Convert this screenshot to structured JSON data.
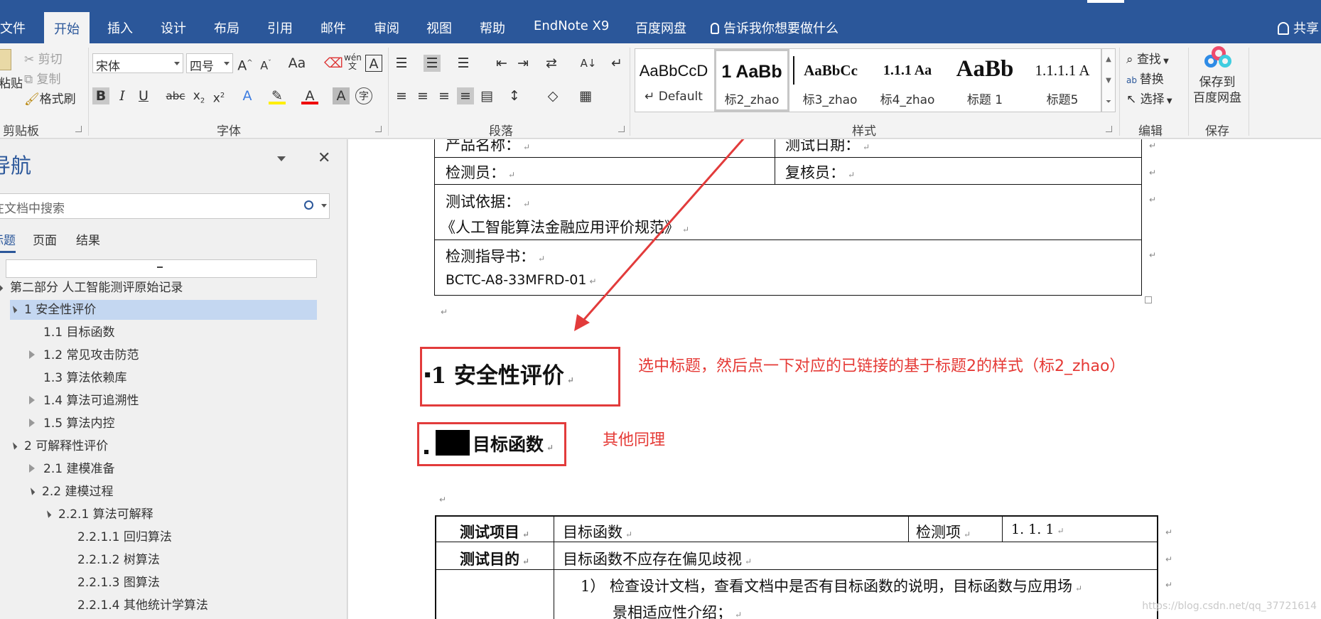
{
  "ribbon_tabs": [
    "文件",
    "开始",
    "插入",
    "设计",
    "布局",
    "引用",
    "邮件",
    "审阅",
    "视图",
    "帮助",
    "EndNote X9",
    "百度网盘"
  ],
  "tell_me": "告诉我你想要做什么",
  "share": "共享",
  "clipboard": {
    "paste": "粘贴",
    "cut": "剪切",
    "copy": "复制",
    "format_painter": "格式刷",
    "group": "剪贴板"
  },
  "font": {
    "name": "宋体",
    "size": "四号",
    "group": "字体"
  },
  "paragraph": {
    "group": "段落"
  },
  "styles": {
    "group": "样式",
    "items": [
      {
        "sample": "AaBbCcD",
        "name": "↵ Default"
      },
      {
        "sample": "1  AaBb",
        "name": "标2_zhao"
      },
      {
        "sample": "AaBbCc",
        "name": "标3_zhao"
      },
      {
        "sample": "1.1.1  Aa",
        "name": "标4_zhao"
      },
      {
        "sample": "AaBb",
        "name": "标题 1"
      },
      {
        "sample": "1.1.1.1  A",
        "name": "标题5"
      }
    ]
  },
  "editing": {
    "find": "查找",
    "replace": "替换",
    "select": "选择",
    "group": "编辑"
  },
  "save": {
    "label": "保存到\n百度网盘",
    "line1": "保存到",
    "line2": "百度网盘",
    "group": "保存"
  },
  "nav": {
    "title": "导航",
    "search_placeholder": "在文档中搜索",
    "tabs": [
      "标题",
      "页面",
      "结果"
    ],
    "items": [
      {
        "label": "第二部分 人工智能测评原始记录",
        "level": 0,
        "toggle": "open"
      },
      {
        "label": "1 安全性评价",
        "level": 1,
        "toggle": "open",
        "selected": true
      },
      {
        "label": "1.1 目标函数",
        "level": 2,
        "toggle": "none"
      },
      {
        "label": "1.2 常见攻击防范",
        "level": 2,
        "toggle": "closed"
      },
      {
        "label": "1.3 算法依赖库",
        "level": 2,
        "toggle": "none"
      },
      {
        "label": "1.4 算法可追溯性",
        "level": 2,
        "toggle": "closed"
      },
      {
        "label": "1.5 算法内控",
        "level": 2,
        "toggle": "closed"
      },
      {
        "label": "2 可解释性评价",
        "level": 1,
        "toggle": "open"
      },
      {
        "label": "2.1 建模准备",
        "level": 2,
        "toggle": "closed"
      },
      {
        "label": "2.2 建模过程",
        "level": 2,
        "toggle": "open"
      },
      {
        "label": "2.2.1 算法可解释",
        "level": 3,
        "toggle": "open"
      },
      {
        "label": "2.2.1.1 回归算法",
        "level": 4,
        "toggle": "none"
      },
      {
        "label": "2.2.1.2 树算法",
        "level": 4,
        "toggle": "none"
      },
      {
        "label": "2.2.1.3 图算法",
        "level": 4,
        "toggle": "none"
      },
      {
        "label": "2.2.1.4 其他统计学算法",
        "level": 4,
        "toggle": "none"
      }
    ]
  },
  "doc": {
    "row_product": "产品名称：",
    "row_date": "测试日期：",
    "row_tester": "检测员：",
    "row_reviewer": "复核员：",
    "basis_label": "测试依据：",
    "basis_value": "《人工智能算法金融应用评价规范》",
    "guide_label": "检测指导书：",
    "guide_value": "BCTC-A8-33MFRD-01",
    "heading1": "1    安全性评价",
    "heading2": "目标函数",
    "annotation1": "选中标题，然后点一下对应的已链接的基于标题2的样式（标2_zhao）",
    "annotation2": "其他同理",
    "t2_item_label": "测试项目",
    "t2_item_value": "目标函数",
    "t2_check_label": "检测项",
    "t2_check_value": "1. 1. 1",
    "t2_purpose_label": "测试目的",
    "t2_purpose_value": "目标函数不应存在偏见歧视",
    "t2_step1": "1）  检查设计文档，查看文档中是否有目标函数的说明，目标函数与应用场",
    "t2_step1b": "景相适应性介绍；",
    "watermark": "https://blog.csdn.net/qq_37721614"
  }
}
